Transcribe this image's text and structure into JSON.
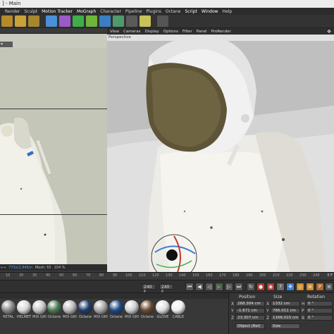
{
  "window": {
    "title": "] - Main"
  },
  "menubar": {
    "items": [
      "Render",
      "Sculpt",
      "Motion Tracker",
      "MoGraph",
      "Character",
      "Pipeline",
      "Plugins",
      "Octane",
      "Script",
      "Window",
      "Help"
    ]
  },
  "viewport": {
    "menu": [
      "View",
      "Cameras",
      "Display",
      "Options",
      "Filter",
      "Panel",
      "ProRender"
    ],
    "label": "Perspective"
  },
  "left_status": {
    "coords": "773x(1.645m",
    "mesh_label": "Mesh: 55",
    "zoom": "104 %"
  },
  "timeline": {
    "ticks": [
      "10",
      "20",
      "30",
      "40",
      "50",
      "60",
      "70",
      "80",
      "90",
      "100",
      "110",
      "120",
      "130",
      "140",
      "150",
      "160",
      "170",
      "180",
      "190",
      "200",
      "210",
      "220",
      "230",
      "240"
    ],
    "current_frame": "240 F",
    "end_frame": "240 F",
    "right_readout": "0 F"
  },
  "materials": [
    {
      "label": "RETAL",
      "color": "#8a8a8a"
    },
    {
      "label": "HELMET",
      "color": "#d9d9d9"
    },
    {
      "label": "MIX GRI",
      "color": "#c8c8c8"
    },
    {
      "label": "Octane",
      "color": "#4a7a55"
    },
    {
      "label": "MIX GRI",
      "color": "#bdbdbd"
    },
    {
      "label": "Octane",
      "color": "#1e3c6e"
    },
    {
      "label": "MIX GRI",
      "color": "#a9a9a9"
    },
    {
      "label": "Octane",
      "color": "#1d4a86"
    },
    {
      "label": "MIX GRI",
      "color": "#cfcfcf"
    },
    {
      "label": "Octane",
      "color": "#6a4a2c"
    },
    {
      "label": "GLOVE",
      "color": "#e0e0e0"
    },
    {
      "label": "CABLE",
      "color": "#efefef"
    }
  ],
  "coordinates": {
    "position_header": "Position",
    "size_header": "Size",
    "rotation_header": "Rotation",
    "rows": [
      {
        "axis": "X",
        "position": "268.304 cm",
        "size_axis": "X",
        "size": "1332 cm",
        "rot_axis": "H",
        "rotation": "0 °"
      },
      {
        "axis": "Y",
        "position": "-1.671 cm",
        "size_axis": "Y",
        "size": "766.011 cm",
        "rot_axis": "P",
        "rotation": "0 °"
      },
      {
        "axis": "Z",
        "position": "23.307 cm",
        "size_axis": "Z",
        "size": "1166.015 cm",
        "rot_axis": "B",
        "rotation": "0 °"
      }
    ],
    "mode": "Object (Rel)",
    "size_mode": "Size"
  },
  "colors": {
    "menubar_bg": "#2c2c2c",
    "accent_blue": "#3f7fd0",
    "record_red": "#c0392b",
    "play_green": "#3fae49"
  }
}
